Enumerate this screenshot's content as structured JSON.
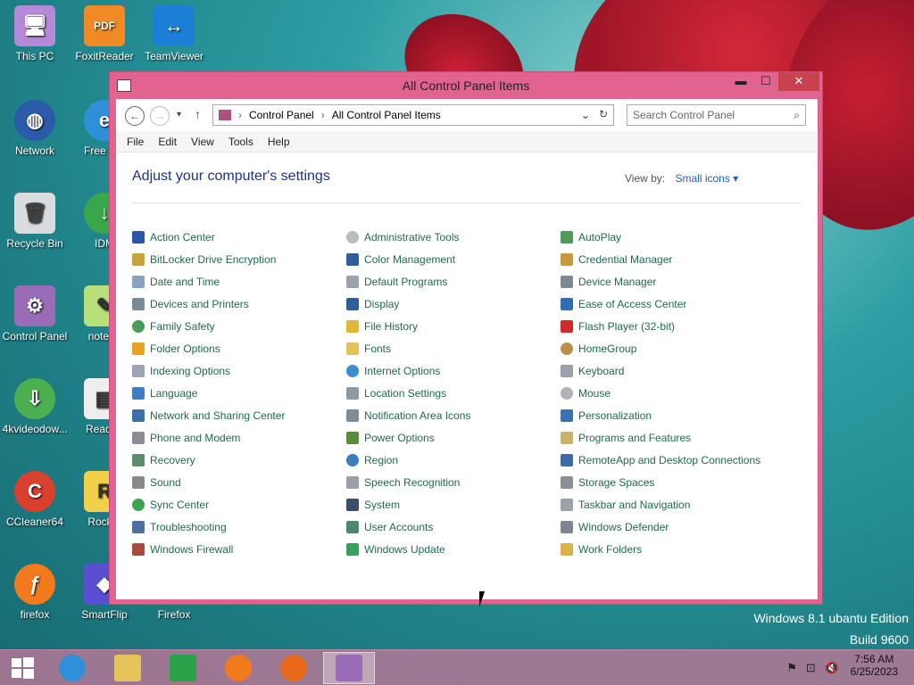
{
  "desktop": {
    "icons": [
      {
        "label": "This PC"
      },
      {
        "label": "FoxitReader"
      },
      {
        "label": "TeamViewer"
      },
      {
        "label": "Network"
      },
      {
        "label": "Free Sof"
      },
      {
        "label": "Recycle Bin"
      },
      {
        "label": "IDM"
      },
      {
        "label": "Control Panel"
      },
      {
        "label": "notepa"
      },
      {
        "label": "4kvideodow..."
      },
      {
        "label": "Read M"
      },
      {
        "label": "CCleaner64"
      },
      {
        "label": "Rocket"
      },
      {
        "label": "firefox"
      },
      {
        "label": "SmartFlip"
      },
      {
        "label": "Firefox"
      }
    ],
    "watermark_line1": "Windows 8.1 ubantu Edition",
    "watermark_line2": "Build 9600"
  },
  "window": {
    "title": "All Control Panel Items",
    "minimize": "▬",
    "maximize": "☐",
    "close": "✕",
    "breadcrumb": [
      "Control Panel",
      "All Control Panel Items"
    ],
    "search_placeholder": "Search Control Panel",
    "menu": [
      "File",
      "Edit",
      "View",
      "Tools",
      "Help"
    ],
    "heading": "Adjust your computer's settings",
    "view_by_label": "View by:",
    "view_by_value": "Small icons",
    "items_col1": [
      "Action Center",
      "BitLocker Drive Encryption",
      "Date and Time",
      "Devices and Printers",
      "Family Safety",
      "Folder Options",
      "Indexing Options",
      "Language",
      "Network and Sharing Center",
      "Phone and Modem",
      "Recovery",
      "Sound",
      "Sync Center",
      "Troubleshooting",
      "Windows Firewall"
    ],
    "items_col2": [
      "Administrative Tools",
      "Color Management",
      "Default Programs",
      "Display",
      "File History",
      "Fonts",
      "Internet Options",
      "Location Settings",
      "Notification Area Icons",
      "Power Options",
      "Region",
      "Speech Recognition",
      "System",
      "User Accounts",
      "Windows Update"
    ],
    "items_col3": [
      "AutoPlay",
      "Credential Manager",
      "Device Manager",
      "Ease of Access Center",
      "Flash Player (32-bit)",
      "HomeGroup",
      "Keyboard",
      "Mouse",
      "Personalization",
      "Programs and Features",
      "RemoteApp and Desktop Connections",
      "Storage Spaces",
      "Taskbar and Navigation",
      "Windows Defender",
      "Work Folders"
    ]
  },
  "taskbar": {
    "time": "7:56 AM",
    "date": "6/25/2023"
  }
}
